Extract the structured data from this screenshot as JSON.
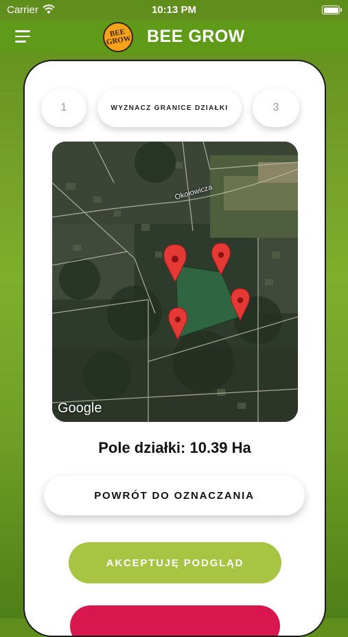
{
  "status_bar": {
    "carrier": "Carrier",
    "time": "10:13 PM"
  },
  "header": {
    "title": "BEE GROW",
    "logo_text": "BEE GROW"
  },
  "steps": [
    {
      "label": "1"
    },
    {
      "label": "WYZNACZ GRANICE DZIAŁKI"
    },
    {
      "label": "3"
    }
  ],
  "map": {
    "street_label": "Okołowicza",
    "attribution": "Google",
    "markers": [
      "pin-icon",
      "pin-icon",
      "pin-icon",
      "pin-icon"
    ]
  },
  "area_text": "Pole działki: 10.39 Ha",
  "buttons": {
    "back": "POWRÓT DO OZNACZANIA",
    "accept": "AKCEPTUJĘ PODGLĄD"
  },
  "colors": {
    "header": "#5f9a18",
    "accept_button": "#a7c443",
    "next_button": "#d8174e",
    "marker": "#e53935"
  }
}
